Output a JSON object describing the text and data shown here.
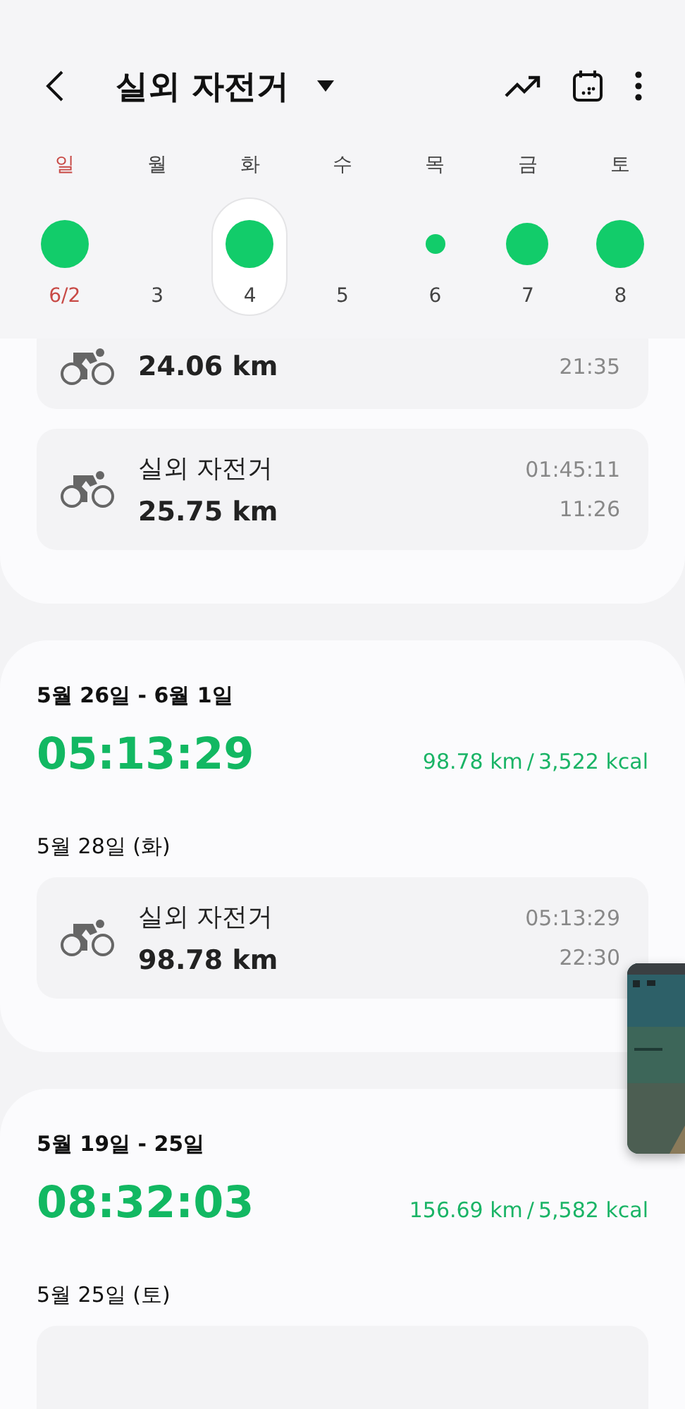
{
  "header": {
    "title": "실외 자전거"
  },
  "week": [
    {
      "weekday": "일",
      "date": "6/2",
      "kind": "large",
      "holiday": true,
      "selected": false
    },
    {
      "weekday": "월",
      "date": "3",
      "kind": "none",
      "holiday": false,
      "selected": false
    },
    {
      "weekday": "화",
      "date": "4",
      "kind": "large",
      "holiday": false,
      "selected": true
    },
    {
      "weekday": "수",
      "date": "5",
      "kind": "none",
      "holiday": false,
      "selected": false
    },
    {
      "weekday": "목",
      "date": "6",
      "kind": "small",
      "holiday": false,
      "selected": false
    },
    {
      "weekday": "금",
      "date": "7",
      "kind": "medium",
      "holiday": false,
      "selected": false
    },
    {
      "weekday": "토",
      "date": "8",
      "kind": "large",
      "holiday": false,
      "selected": false
    }
  ],
  "sections": [
    {
      "days": [
        {
          "workouts": [
            {
              "distance": "24.06 km",
              "time": "21:35",
              "clipped": true
            },
            {
              "name": "실외 자전거",
              "distance": "25.75 km",
              "duration": "01:45:11",
              "time": "11:26",
              "clipped": false
            }
          ]
        }
      ]
    },
    {
      "range": "5월 26일 - 6월 1일",
      "total_time": "05:13:29",
      "distance": "98.78  km",
      "separator": "/",
      "calories": "3,522  kcal",
      "days": [
        {
          "date": "5월 28일 (화)",
          "workouts": [
            {
              "name": "실외 자전거",
              "distance": "98.78 km",
              "duration": "05:13:29",
              "time": "22:30",
              "clipped": false
            }
          ]
        }
      ]
    },
    {
      "range": "5월 19일 - 25일",
      "total_time": "08:32:03",
      "distance": "156.69  km",
      "separator": "/",
      "calories": "5,582  kcal",
      "days": [
        {
          "date": "5월 25일 (토)"
        }
      ]
    }
  ]
}
